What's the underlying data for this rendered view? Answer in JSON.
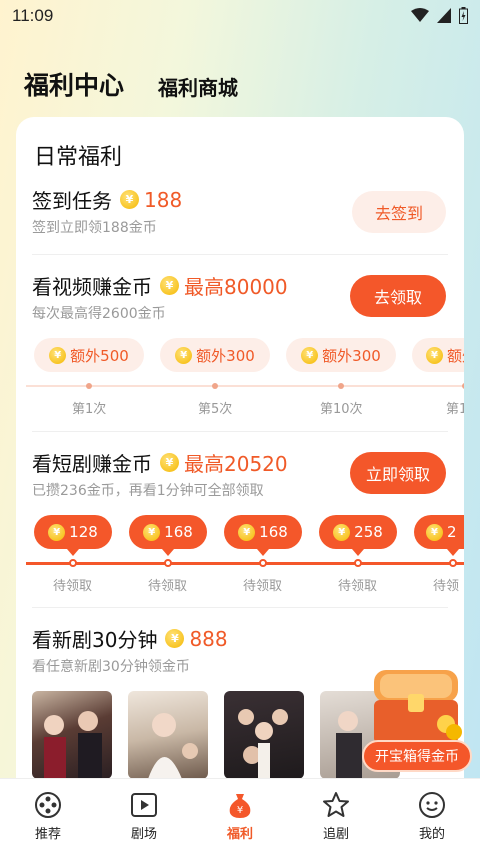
{
  "status_bar": {
    "time": "11:09"
  },
  "header": {
    "tab_welfare_center": "福利中心",
    "tab_welfare_mall": "福利商城"
  },
  "daily": {
    "title": "日常福利",
    "checkin": {
      "title": "签到任务",
      "reward": "188",
      "subtitle": "签到立即领188金币",
      "button": "去签到"
    },
    "video": {
      "title": "看视频赚金币",
      "reward": "最高80000",
      "subtitle": "每次最高得2600金币",
      "button": "去领取",
      "bonuses": [
        {
          "label": "额外500",
          "tick": "第1次"
        },
        {
          "label": "额外300",
          "tick": "第5次"
        },
        {
          "label": "额外300",
          "tick": "第10次"
        },
        {
          "label": "额外",
          "tick": "第1"
        }
      ]
    },
    "drama": {
      "title": "看短剧赚金币",
      "reward": "最高20520",
      "subtitle": "已攒236金币，再看1分钟可全部领取",
      "button": "立即领取",
      "rewards": [
        {
          "value": "128",
          "status": "待领取"
        },
        {
          "value": "168",
          "status": "待领取"
        },
        {
          "value": "168",
          "status": "待领取"
        },
        {
          "value": "258",
          "status": "待领取"
        },
        {
          "value": "2",
          "status": "待领"
        }
      ]
    },
    "new_drama": {
      "title": "看新剧30分钟",
      "reward": "888",
      "subtitle": "看任意新剧30分钟领金币"
    }
  },
  "treasure": {
    "button": "开宝箱得金币"
  },
  "bottom_nav": {
    "items": [
      {
        "label": "推荐",
        "icon": "film-reel-icon"
      },
      {
        "label": "剧场",
        "icon": "play-icon"
      },
      {
        "label": "福利",
        "icon": "money-bag-icon"
      },
      {
        "label": "追剧",
        "icon": "star-icon"
      },
      {
        "label": "我的",
        "icon": "face-icon"
      }
    ],
    "active": "福利"
  },
  "colors": {
    "accent": "#f4572a",
    "accent_light": "#fdeee8",
    "coin": "#f5b800"
  }
}
